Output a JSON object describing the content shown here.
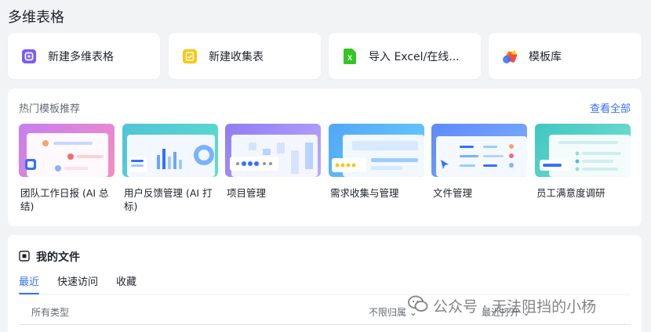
{
  "page_title": "多维表格",
  "actions": [
    {
      "label": "新建多维表格",
      "icon": "base-icon",
      "color": "#7a5af8"
    },
    {
      "label": "新建收集表",
      "icon": "form-icon",
      "color": "#ffc60a"
    },
    {
      "label": "导入 Excel/在线...",
      "icon": "excel-icon",
      "color": "#34c724"
    },
    {
      "label": "模板库",
      "icon": "template-library-icon",
      "color": "#f54a45"
    }
  ],
  "templates": {
    "heading": "热门模板推荐",
    "view_all": "查看全部",
    "items": [
      {
        "label": "团队工作日报 (AI 总结)"
      },
      {
        "label": "用户反馈管理 (AI 打标)"
      },
      {
        "label": "项目管理"
      },
      {
        "label": "需求收集与管理"
      },
      {
        "label": "文件管理"
      },
      {
        "label": "员工满意度调研"
      }
    ]
  },
  "my_files": {
    "title": "我的文件",
    "tabs": [
      "最近",
      "快速访问",
      "收藏"
    ],
    "active_tab": "最近",
    "filters": {
      "type": "所有类型",
      "owner": "不限归属",
      "sort": "最近打开"
    }
  },
  "watermark": "公众号 · 无法阻挡的小杨",
  "colors": {
    "accent": "#3370ff",
    "background": "#f2f3f5"
  }
}
